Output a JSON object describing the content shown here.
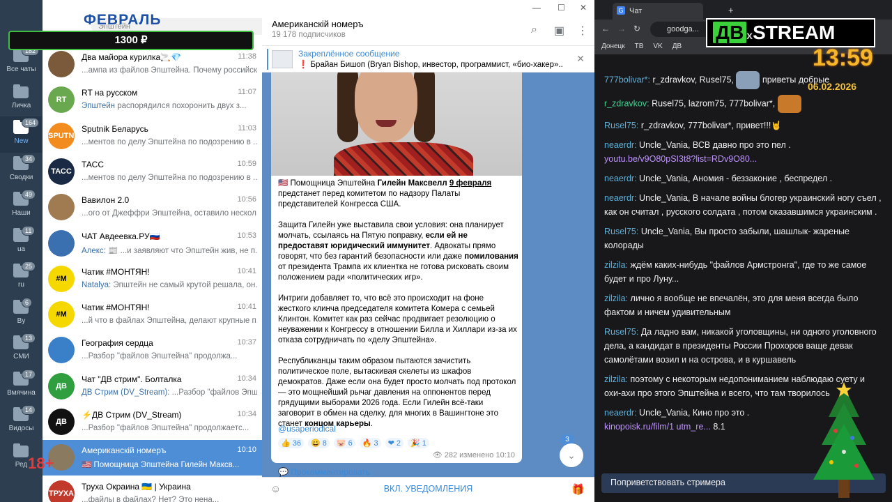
{
  "overlay": {
    "month": "ФЕВРАЛЬ",
    "price": "1300 ₽",
    "age_rating": "18+"
  },
  "search": {
    "placeholder": "Эпштейн"
  },
  "folders": [
    {
      "label": "Все чаты",
      "badge": "182"
    },
    {
      "label": "Личка",
      "badge": ""
    },
    {
      "label": "New",
      "badge": "164"
    },
    {
      "label": "Сводки",
      "badge": "34"
    },
    {
      "label": "Наши",
      "badge": "49"
    },
    {
      "label": "ua",
      "badge": "11"
    },
    {
      "label": "ru",
      "badge": "25"
    },
    {
      "label": "By",
      "badge": "6"
    },
    {
      "label": "СМИ",
      "badge": "13"
    },
    {
      "label": "Вмячина",
      "badge": "17"
    },
    {
      "label": "Видосы",
      "badge": "14"
    },
    {
      "label": "Ред",
      "badge": ""
    }
  ],
  "chats": [
    {
      "title": "Два майора курилка🚬💎",
      "time": "11:38",
      "sender": "",
      "preview": "...ампа из файлов Эпштейна. Почему российск...",
      "avatar": "#7a5a3a",
      "av_text": ""
    },
    {
      "title": "RT на русском",
      "time": "11:07",
      "sender": "Эпштейн",
      "preview": " распорядился похоронить двух з...",
      "avatar": "#6aa84f",
      "av_text": "RT"
    },
    {
      "title": "Sputnik Беларусь",
      "time": "11:03",
      "sender": "",
      "preview": "...ментов по делу Эпштейна по подозрению в ...",
      "avatar": "#f28c1f",
      "av_text": "SPUTNIK"
    },
    {
      "title": "ТАСС",
      "time": "10:59",
      "sender": "",
      "preview": "...ментов по делу Эпштейна по подозрению в ...",
      "avatar": "#1a2a44",
      "av_text": "ТАСС"
    },
    {
      "title": "Вавилон 2.0",
      "time": "10:56",
      "sender": "",
      "preview": "...ого от Джеффри Эпштейна, оставило нескол...",
      "avatar": "#a07a50",
      "av_text": ""
    },
    {
      "title": "ЧАТ Авдеевка.РУ🇷🇺",
      "time": "10:53",
      "sender": "Алекс:",
      "preview": " 📰 ...и заявляют что Эпштейн жив, не п...",
      "avatar": "#3a6fb0",
      "av_text": ""
    },
    {
      "title": "Чатик #МОНТЯН!",
      "time": "10:41",
      "sender": "Natalya:",
      "preview": " Эпштейн не самый крутой решала, он...",
      "avatar": "#f5d800",
      "av_text": "#M"
    },
    {
      "title": "Чатик #МОНТЯН!",
      "time": "10:41",
      "sender": "",
      "preview": "...й что в файлах Эпштейна, делают крупные п...",
      "avatar": "#f5d800",
      "av_text": "#M"
    },
    {
      "title": "География сердца",
      "time": "10:37",
      "sender": "",
      "preview": "...Разбор \"файлов Эпштейна\" продолжа...",
      "avatar": "#3a80c8",
      "av_text": ""
    },
    {
      "title": "Чат \"ДВ стрим\". Болталка",
      "time": "10:34",
      "sender": "ДВ Стрим (DV_Stream):",
      "preview": " ...Разбор \"файлов Эпш...",
      "avatar": "#2e9e3e",
      "av_text": "ДВ"
    },
    {
      "title": "⚡ДВ Стрим (DV_Stream)",
      "time": "10:34",
      "sender": "",
      "preview": "...Разбор \"файлов Эпштейна\" продолжаетс...",
      "avatar": "#111111",
      "av_text": "ДВ"
    },
    {
      "title": "Американскiй номеръ",
      "time": "10:10",
      "sender": "",
      "preview": "🇺🇸 Помощница Эпштейна Гилейн Максв...",
      "avatar": "#8a7a60",
      "av_text": ""
    },
    {
      "title": "Труха Окраина 🇺🇦 | Украина",
      "time": "",
      "sender": "",
      "preview": "...файлы в файлах? Нет? Это нена...",
      "avatar": "#c0392b",
      "av_text": "ТРУХА"
    }
  ],
  "channel": {
    "title": "Американскiй номеръ",
    "subscribers": "19 178 подписчиков"
  },
  "pinned": {
    "label": "Закреплённое сообщение",
    "text": "❗ Брайан Бишоп (Bryan Bishop, инвестор, программист, «био-хакер»..."
  },
  "message": {
    "p1_a": "🇺🇸 Помощница Эпштейна ",
    "p1_b": "Гилейн Максвелл",
    "p1_c": " ",
    "p1_d": "9 февраля",
    "p1_e": " предстанет перед комитетом по надзору Палаты представителей Конгресса США.",
    "p2_a": "Защита Гилейн уже выставила свои условия: она планирует молчать, ссылаясь на Пятую поправку, ",
    "p2_b": "если ей не предоставят юридический иммунитет",
    "p2_c": ". Адвокаты прямо говорят, что без гарантий безопасности или даже ",
    "p2_d": "помилования",
    "p2_e": " от президента Трампа их клиентка не готова рисковать своим положением ради «политических игр».",
    "p3": "Интриги добавляет то, что всё это происходит на фоне жесткого клинча председателя комитета Комера с семьей Клинтон. Комитет как раз сейчас продвигает резолюцию о неуважении к Конгрессу в отношении Билла и Хиллари из-за их отказа сотрудничать по «делу Эпштейна».",
    "p4_a": "Республиканцы таким образом пытаются зачистить политическое поле, вытаскивая скелеты из шкафов демократов. Даже если она будет просто молчать под протокол — это мощнейший рычаг давления на оппонентов перед грядущими выборами 2026 года. Если Гилейн всё-таки заговорит в обмен на сделку, для многих в Вашингтоне это станет ",
    "p4_b": "концом карьеры",
    "p4_c": ".",
    "link": "@usaperiodical",
    "reactions": [
      "👍 36",
      "😀 8",
      "🐷 6",
      "🔥 3",
      "❤ 2",
      "🎉 1"
    ],
    "views": "282",
    "edited": "изменено 10:10",
    "comment": "Прокомментировать"
  },
  "unread_count": "3",
  "notifications_label": "ВКЛ. УВЕДОМЛЕНИЯ",
  "browser": {
    "tab_title": "Чат",
    "url": "goodga...",
    "bookmarks": [
      "Донецк",
      "TB",
      "VK",
      "ДВ"
    ]
  },
  "stream": {
    "logo_left": "ДВ",
    "logo_x": "x",
    "logo_right": "STREAM",
    "clock": "13:59",
    "date": "06.02.2026"
  },
  "chat": [
    {
      "nick": "777bolivar*:",
      "text": " r_zdravkov, Rusel75,",
      "tail": " приветы добрые",
      "green": false
    },
    {
      "nick": "r_zdravkov:",
      "text": " Rusel75, lazrom75, 777bolivar*,",
      "tail": "",
      "green": true
    },
    {
      "nick": "Rusel75:",
      "text": " r_zdravkov, 777bolivar*, привет!!!🤘",
      "tail": "",
      "green": false
    },
    {
      "nick": "neaerdr:",
      "text": " Uncle_Vania, ВСВ давно про это пел .",
      "link": "youtu.be/v9O80pSI3t8?list=RDv9O80...",
      "green": false
    },
    {
      "nick": "neaerdr:",
      "text": " Uncle_Vania, Аномия - беззаконие , беспредел .",
      "tail": "",
      "green": false
    },
    {
      "nick": "neaerdr:",
      "text": " Uncle_Vania, В начале войны блогер украинский ногу съел , как он считал , русского солдата , потом оказавшимся украинским .",
      "tail": "",
      "green": false
    },
    {
      "nick": "Rusel75:",
      "text": " Uncle_Vania, Вы просто забыли, шашлык- жареные колорады",
      "tail": "",
      "green": false
    },
    {
      "nick": "zilzila:",
      "text": " ждём каких-нибудь \"файлов Армстронга\", где то же самое будет и про Луну...",
      "tail": "",
      "green": false
    },
    {
      "nick": "zilzila:",
      "text": " лично я вообще не впечалён, это для меня всегда было фактом и ничем удивительным",
      "tail": "",
      "green": false
    },
    {
      "nick": "Rusel75:",
      "text": " Да ладно вам, никакой уголовщины, ни одного уголовного дела, а кандидат в президенты России Прохоров ваще девак самолётами возил и на острова, и в куршавель",
      "tail": "",
      "green": false
    },
    {
      "nick": "zilzila:",
      "text": " поэтому с некоторым недопониманием наблюдаю суету и охи-ахи про этого Эпштейна и всего, что там творилось",
      "tail": "",
      "green": false
    },
    {
      "nick": "neaerdr:",
      "text": " Uncle_Vania, Кино про это .",
      "link": "kinopoisk.ru/film/1 utm_re...",
      "tail2": " 8.1",
      "green": false
    }
  ],
  "greet_button": "Поприветствовать стримера"
}
